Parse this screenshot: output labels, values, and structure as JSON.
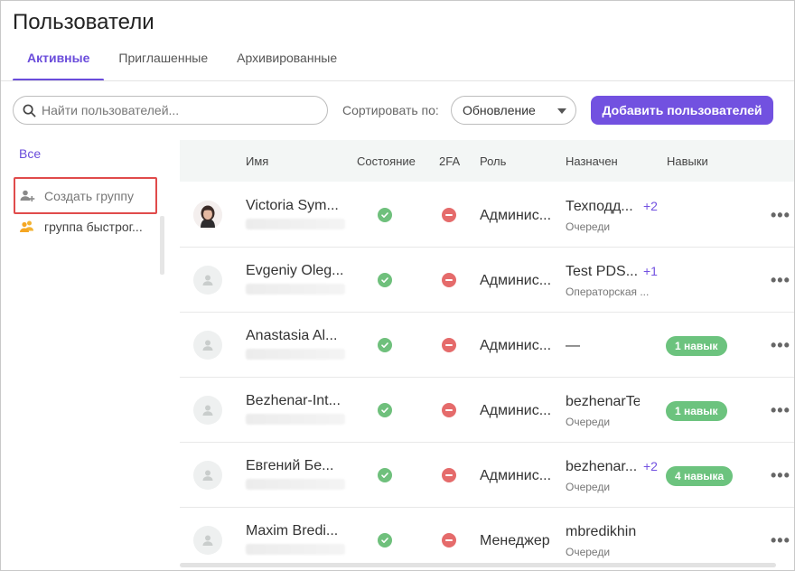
{
  "page": {
    "title": "Пользователи"
  },
  "tabs": [
    {
      "label": "Активные",
      "active": true
    },
    {
      "label": "Приглашенные",
      "active": false
    },
    {
      "label": "Архивированные",
      "active": false
    }
  ],
  "toolbar": {
    "search_placeholder": "Найти пользователей...",
    "sort_label": "Сортировать по:",
    "sort_value": "Обновление",
    "add_button": "Добавить пользователей"
  },
  "sidebar": {
    "all": "Все",
    "create_group": "Создать группу",
    "groups": [
      {
        "label": "группа быстрог..."
      }
    ]
  },
  "table": {
    "columns": {
      "name": "Имя",
      "state": "Состояние",
      "tfa": "2FA",
      "role": "Роль",
      "assigned": "Назначен",
      "skills": "Навыки"
    },
    "rows": [
      {
        "name": "Victoria Sym...",
        "avatar": "photo",
        "state": "active",
        "tfa": "off",
        "role": "Админис...",
        "assigned": "Техподд...",
        "assigned_plus": "+2",
        "assigned_sub": "Очереди",
        "skills": ""
      },
      {
        "name": "Evgeniy Oleg...",
        "avatar": "placeholder",
        "state": "active",
        "tfa": "off",
        "role": "Админис...",
        "assigned": "Test PDS...",
        "assigned_plus": "+1",
        "assigned_sub": "Операторская ...",
        "skills": ""
      },
      {
        "name": "Anastasia Al...",
        "avatar": "placeholder",
        "state": "active",
        "tfa": "off",
        "role": "Админис...",
        "assigned": "—",
        "assigned_plus": "",
        "assigned_sub": "",
        "skills": "1 навык"
      },
      {
        "name": "Bezhenar-Int...",
        "avatar": "placeholder",
        "state": "active",
        "tfa": "off",
        "role": "Админис...",
        "assigned": "bezhenarTe...",
        "assigned_plus": "",
        "assigned_sub": "Очереди",
        "skills": "1 навык"
      },
      {
        "name": "Евгений Бе...",
        "avatar": "placeholder",
        "state": "active",
        "tfa": "off",
        "role": "Админис...",
        "assigned": "bezhenar...",
        "assigned_plus": "+2",
        "assigned_sub": "Очереди",
        "skills": "4 навыка"
      },
      {
        "name": "Maxim Bredi...",
        "avatar": "placeholder",
        "state": "active",
        "tfa": "off",
        "role": "Менеджер",
        "assigned": "mbredikhin ...",
        "assigned_plus": "",
        "assigned_sub": "Очереди",
        "skills": ""
      }
    ]
  },
  "colors": {
    "accent": "#7251e0",
    "success": "#6fc07c",
    "danger": "#e56b6b",
    "highlight": "#e04b4b"
  },
  "icons": {
    "search": "search-icon",
    "sort_caret": "chevron-down-icon",
    "create_group": "group-add-icon",
    "group": "group-icon",
    "more": "more-horizontal-icon",
    "state": "check-circle-icon",
    "tfa": "minus-circle-icon",
    "avatar": "user-icon"
  }
}
